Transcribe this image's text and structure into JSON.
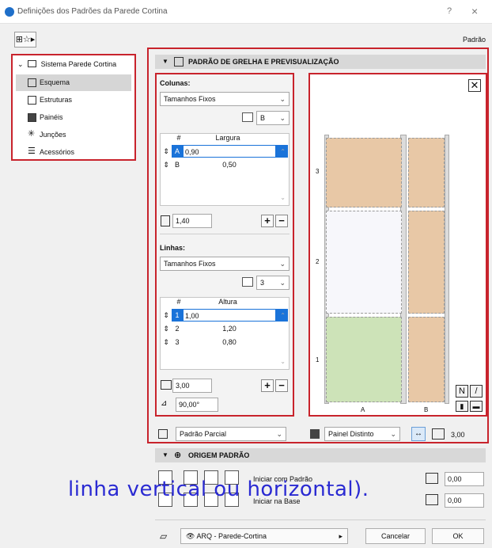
{
  "window": {
    "title": "Definições dos Padrões da Parede Cortina",
    "help": "?",
    "close": "×"
  },
  "topbar": {
    "default_label": "Padrão"
  },
  "tree": {
    "root": "Sistema Parede Cortina",
    "items": [
      {
        "label": "Esquema",
        "selected": true
      },
      {
        "label": "Estruturas"
      },
      {
        "label": "Painéis"
      },
      {
        "label": "Junções"
      },
      {
        "label": "Acessórios"
      }
    ]
  },
  "grid_panel": {
    "title": "PADRÃO DE GRELHA E PREVISUALIZAÇÃO"
  },
  "columns": {
    "label": "Colunas:",
    "mode": "Tamanhos Fixos",
    "count_value": "B",
    "table": {
      "headers": [
        "#",
        "Largura"
      ],
      "rows": [
        {
          "id": "A",
          "value": "0,90"
        },
        {
          "id": "B",
          "value": "0,50"
        }
      ]
    },
    "total": "1,40"
  },
  "rows": {
    "label": "Linhas:",
    "mode": "Tamanhos Fixos",
    "count_value": "3",
    "table": {
      "headers": [
        "#",
        "Altura"
      ],
      "rows": [
        {
          "id": "1",
          "value": "1,00"
        },
        {
          "id": "2",
          "value": "1,20"
        },
        {
          "id": "3",
          "value": "0,80"
        }
      ]
    },
    "total": "3,00",
    "angle": "90,00°"
  },
  "preview": {
    "row_labels": [
      "3",
      "2",
      "1"
    ],
    "col_labels": [
      "A",
      "B"
    ],
    "colors": {
      "peach": "#e8c8a6",
      "white": "#f7f7fb",
      "green": "#cde3b8"
    }
  },
  "bottom_row": {
    "pattern_type": "Padrão Parcial",
    "panel_type": "Painel Distinto",
    "height_value": "3,00"
  },
  "origin_panel": {
    "title": "ORIGEM PADRÃO",
    "start_with_pattern": "Iniciar com Padrão",
    "start_at_base": "Iniciar na Base",
    "value1": "0,00",
    "value2": "0,00"
  },
  "footer": {
    "layer": "ARQ - Parede-Cortina",
    "cancel": "Cancelar",
    "ok": "OK"
  },
  "caption": "linha vertical ou horizontal)."
}
